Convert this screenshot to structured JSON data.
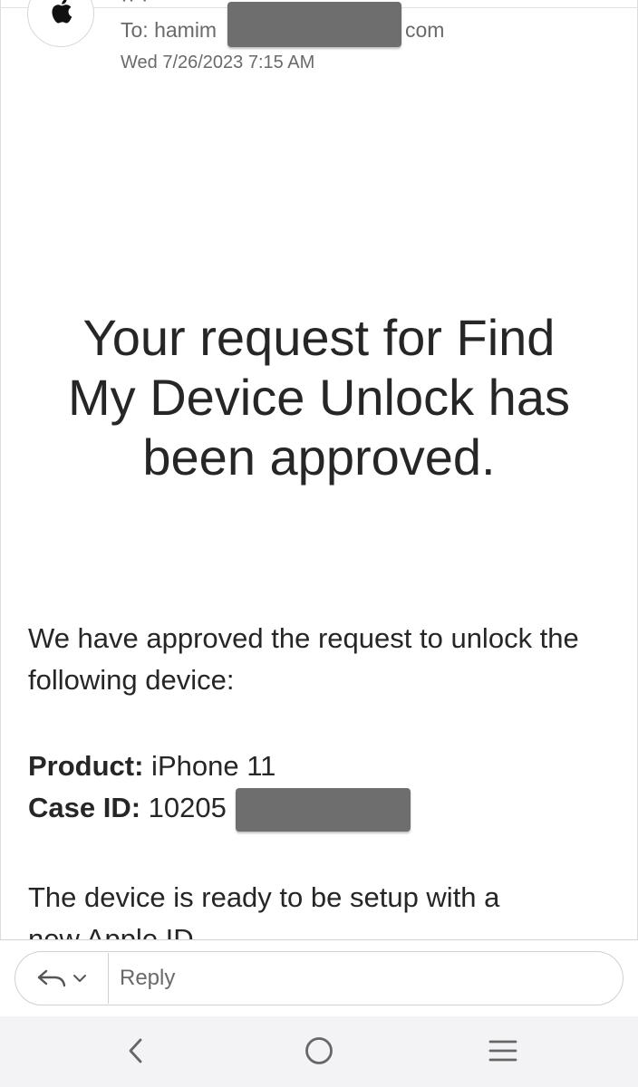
{
  "header": {
    "sender_partial": "·· ·",
    "to_prefix": "To: hamim",
    "to_suffix": "com",
    "date": "Wed 7/26/2023 7:15 AM"
  },
  "body": {
    "headline": "Your request for Find My Device Unlock has been approved.",
    "intro": "We have approved the request to unlock the following device:",
    "fields": [
      {
        "label": "Product:",
        "value": " iPhone 11"
      },
      {
        "label": "Case ID:",
        "value": " 10205"
      }
    ],
    "setup_line": "The device is ready to be setup with a",
    "setup_line_cut": "new Apple ID"
  },
  "reply_bar": {
    "reply_placeholder": "Reply",
    "reply_icon": "reply-arrow-icon",
    "dropdown_icon": "chevron-down-icon"
  },
  "nav": {
    "back_icon": "back-chevron-icon",
    "home_icon": "home-circle-icon",
    "recents_icon": "menu-lines-icon"
  },
  "colors": {
    "redaction": "#6e6e6e",
    "text": "#262626",
    "muted": "#6a6a6a",
    "navbar": "#f3f3f5"
  }
}
